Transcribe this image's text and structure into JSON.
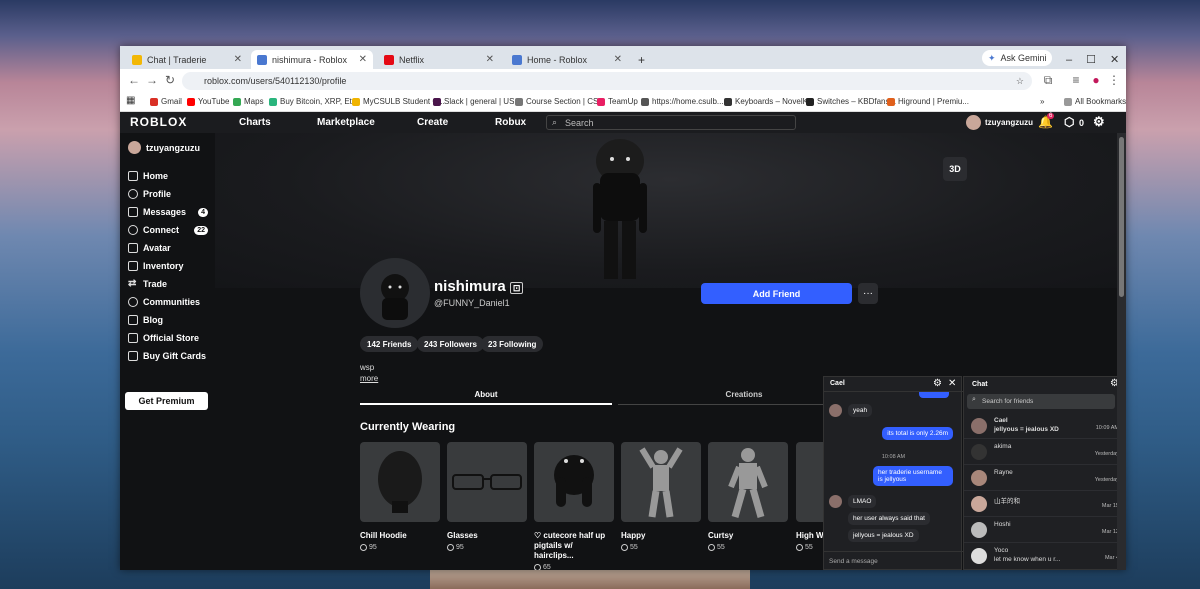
{
  "tabs": [
    {
      "label": "Chat | Traderie",
      "color": "#f2b705"
    },
    {
      "label": "nishimura - Roblox",
      "color": "#4a78d0"
    },
    {
      "label": "Netflix",
      "color": "#e50914"
    },
    {
      "label": "Home - Roblox",
      "color": "#4a78d0"
    }
  ],
  "ask_gemini": "Ask Gemini",
  "url": "roblox.com/users/540112130/profile",
  "bookmarks": [
    {
      "label": "Gmail",
      "color": "#d93025"
    },
    {
      "label": "YouTube",
      "color": "#ff0000"
    },
    {
      "label": "Maps",
      "color": "#34a853"
    },
    {
      "label": "Buy Bitcoin, XRP, Et...",
      "color": "#2ab57d"
    },
    {
      "label": "MyCSULB Student C...",
      "color": "#f0b400"
    },
    {
      "label": "Slack | general | US...",
      "color": "#4a154b"
    },
    {
      "label": "Course Section | CS...",
      "color": "#777"
    },
    {
      "label": "TeamUp",
      "color": "#e91e63"
    },
    {
      "label": "https://home.csulb....",
      "color": "#555"
    },
    {
      "label": "Keyboards – NovelK...",
      "color": "#333"
    },
    {
      "label": "Switches – KBDfans...",
      "color": "#222"
    },
    {
      "label": "Higround | Premiu...",
      "color": "#e0601c"
    }
  ],
  "all_bookmarks": "All Bookmarks",
  "nav": {
    "logo": "ROBLOX",
    "charts": "Charts",
    "marketplace": "Marketplace",
    "create": "Create",
    "robux": "Robux",
    "search_placeholder": "Search",
    "user": "tzuyangzuzu",
    "notif_count": "6",
    "robux_count": "0"
  },
  "sidebar": {
    "user": "tzuyangzuzu",
    "items": [
      {
        "label": "Home"
      },
      {
        "label": "Profile"
      },
      {
        "label": "Messages",
        "badge": "4"
      },
      {
        "label": "Connect",
        "badge": "22"
      },
      {
        "label": "Avatar"
      },
      {
        "label": "Inventory"
      },
      {
        "label": "Trade"
      },
      {
        "label": "Communities"
      },
      {
        "label": "Blog"
      },
      {
        "label": "Official Store"
      },
      {
        "label": "Buy Gift Cards"
      }
    ],
    "premium": "Get Premium"
  },
  "profile": {
    "btn_3d": "3D",
    "name": "nishimura",
    "handle": "@FUNNY_Daniel1",
    "add_friend": "Add Friend",
    "more": "···",
    "friends": "142 Friends",
    "followers": "243 Followers",
    "following": "23 Following",
    "bio": "wsp",
    "more_link": "more",
    "tab_about": "About",
    "tab_creations": "Creations"
  },
  "wearing": {
    "title": "Currently Wearing",
    "items": [
      {
        "name": "Chill Hoodie",
        "price": "95"
      },
      {
        "name": "Glasses",
        "price": "95"
      },
      {
        "name": "♡ cutecore half up pigtails w/ hairclips...",
        "price": "65"
      },
      {
        "name": "Happy",
        "price": "55"
      },
      {
        "name": "Curtsy",
        "price": "55"
      },
      {
        "name": "High W",
        "price": "55"
      }
    ]
  },
  "chat_window": {
    "title": "Cael",
    "messages": [
      "yeah",
      "its total is only 2.26m",
      "10:08 AM",
      "her traderie username is jellyous",
      "LMAO",
      "her user always said that",
      "jellyous = jealous XD"
    ],
    "input_placeholder": "Send a message"
  },
  "chat_list": {
    "title": "Chat",
    "search_placeholder": "Search for friends",
    "items": [
      {
        "name": "Cael",
        "preview": "jellyous = jealous XD",
        "time": "10:09 AM"
      },
      {
        "name": "akima",
        "preview": "",
        "time": "Yesterday"
      },
      {
        "name": "Rayne",
        "preview": "",
        "time": "Yesterday"
      },
      {
        "name": "山羊的和",
        "preview": "",
        "time": "Mar 15"
      },
      {
        "name": "Hoshi",
        "preview": "",
        "time": "Mar 12"
      },
      {
        "name": "Yoco",
        "preview": "let me know when u r...",
        "time": "Mar 4"
      }
    ]
  }
}
